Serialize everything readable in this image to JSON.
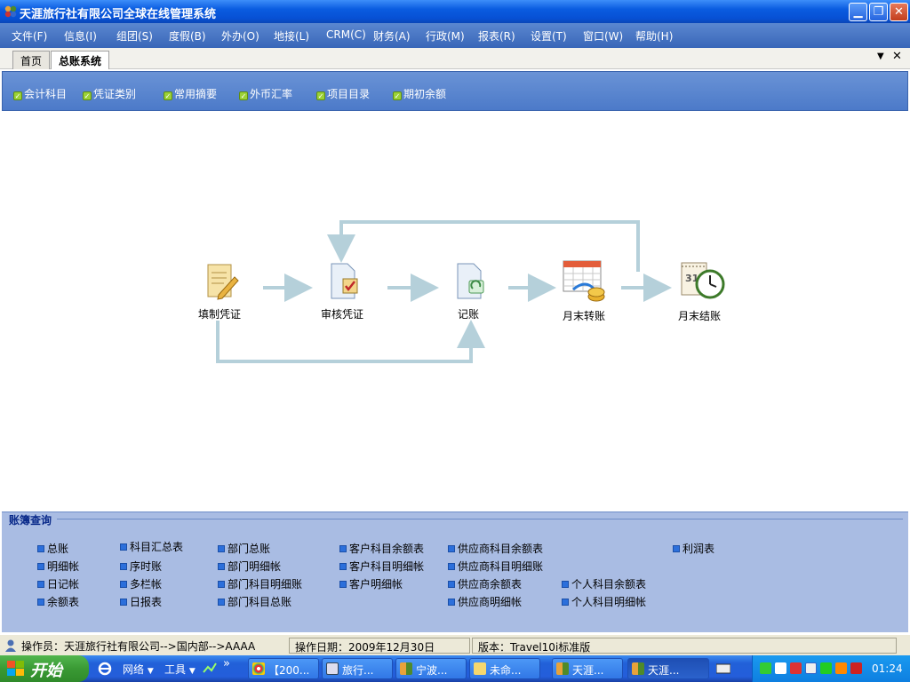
{
  "window": {
    "title": "天涯旅行社有限公司全球在线管理系统"
  },
  "menu": [
    "文件(F)",
    "信息(I)",
    "组团(S)",
    "度假(B)",
    "外办(O)",
    "地接(L)",
    "CRM(C)",
    "财务(A)",
    "行政(M)",
    "报表(R)",
    "设置(T)",
    "窗口(W)",
    "帮助(H)"
  ],
  "tabs": [
    "首页",
    "总账系统"
  ],
  "toolbar": [
    "会计科目",
    "凭证类别",
    "常用摘要",
    "外币汇率",
    "项目目录",
    "期初余额"
  ],
  "flow": {
    "nodes": [
      {
        "label": "填制凭证",
        "icon": "notepad-pencil-icon"
      },
      {
        "label": "审核凭证",
        "icon": "document-check-icon"
      },
      {
        "label": "记账",
        "icon": "document-refresh-icon"
      },
      {
        "label": "月末转账",
        "icon": "calendar-coins-icon"
      },
      {
        "label": "月末结账",
        "icon": "calendar-clock-icon",
        "day": "31"
      }
    ]
  },
  "ledger": {
    "title": "账簿查询",
    "col1": [
      "总账",
      "明细帐",
      "日记帐",
      "余额表"
    ],
    "col2": [
      "科目汇总表",
      "序时账",
      "多栏帐",
      "日报表"
    ],
    "col3": [
      "部门总账",
      "部门明细帐",
      "部门科目明细账",
      "部门科目总账"
    ],
    "col4": [
      "客户科目余额表",
      "客户科目明细帐",
      "客户明细帐"
    ],
    "col5": [
      "供应商科目余额表",
      "供应商科目明细账",
      "供应商余额表",
      "供应商明细帐"
    ],
    "col6": [
      "个人科目余额表",
      "个人科目明细帐"
    ],
    "col7": [
      "利润表"
    ]
  },
  "status": {
    "operator": "操作员：天涯旅行社有限公司-->国内部-->AAAA",
    "date": "操作日期：2009年12月30日",
    "version": "版本：Travel10i标准版"
  },
  "taskbar": {
    "start": "开始",
    "network": "网络",
    "tools": "工具",
    "buttons": [
      "【200...",
      "旅行...",
      "宁波...",
      "未命...",
      "天涯...",
      "天涯..."
    ],
    "clock": "01:24"
  },
  "colors": {
    "titlebar": "#0a5ce0",
    "menubar": "#4671c0",
    "toolbar": "#5a86cf",
    "ledger": "#a9bce3",
    "start": "#3a9a34"
  }
}
